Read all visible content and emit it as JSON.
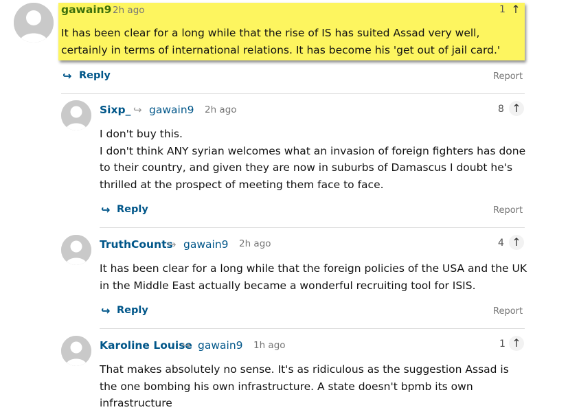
{
  "comments": [
    {
      "username": "gawain9",
      "time": "2h ago",
      "recommend_count": "1",
      "body": "It has been clear for a long while that the rise of IS has suited Assad very well, certainly in terms of international relations. It has become his 'get out of jail card.'",
      "reply_label": "Reply",
      "report_label": "Report"
    },
    {
      "username": "Sixp_",
      "reply_to": "gawain9",
      "time": "2h ago",
      "recommend_count": "8",
      "body_lines": [
        "I don't buy this.",
        "I don't think ANY syrian welcomes what an invasion of foreign fighters has done to their country, and given they are now in suburbs of Damascus I doubt he's thrilled at the prospect of meeting them face to face."
      ],
      "reply_label": "Reply",
      "report_label": "Report"
    },
    {
      "username": "TruthCounts",
      "reply_to": "gawain9",
      "time": "2h ago",
      "recommend_count": "4",
      "body": "It has been clear for a long while that the foreign policies of the USA and the UK in the Middle East actually became a wonderful recruiting tool for ISIS.",
      "reply_label": "Reply",
      "report_label": "Report"
    },
    {
      "username": "Karoline Louise",
      "reply_to": "gawain9",
      "time": "1h ago",
      "recommend_count": "1",
      "body": "That makes absolutely no sense. It's as ridiculous as the suggestion Assad is the one bombing his own infrastructure. A state doesn't bpmb its own infrastructure"
    }
  ],
  "icons": {
    "avatar": "avatar-placeholder-icon",
    "reply_arrow": "reply-arrow-icon",
    "recommend": "recommend-up-arrow-icon"
  },
  "colors": {
    "highlight": "#fdf55f",
    "link": "#005689",
    "top_username": "#3d6f0b"
  }
}
